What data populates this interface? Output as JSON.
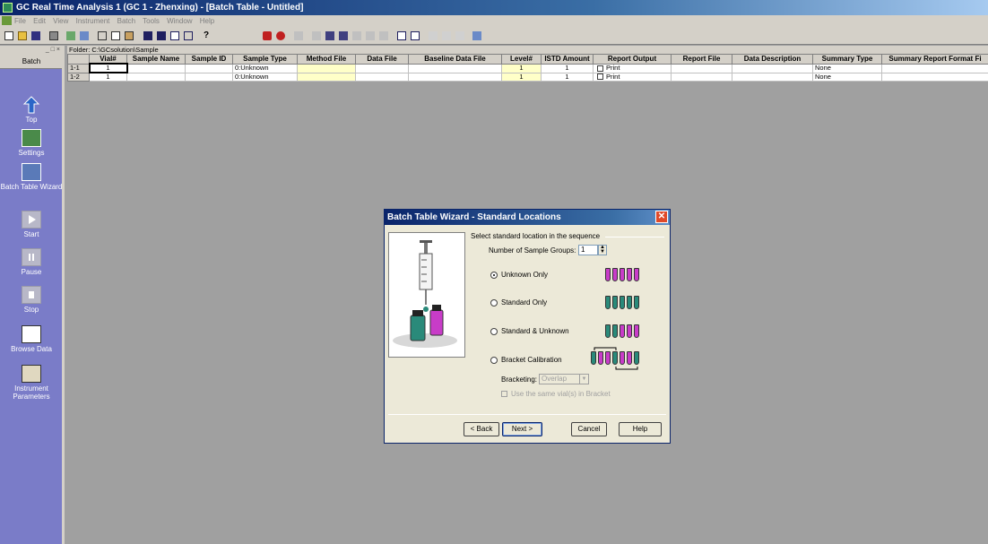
{
  "window": {
    "title": "GC Real Time Analysis 1 (GC 1 - Zhenxing) - [Batch Table - Untitled]"
  },
  "menu": [
    "File",
    "Edit",
    "View",
    "Instrument",
    "Batch",
    "Tools",
    "Window",
    "Help"
  ],
  "sidebar": {
    "header": "Batch",
    "items": [
      {
        "label": "Top",
        "icon": "up-arrow-icon"
      },
      {
        "label": "Settings",
        "icon": "settings-icon"
      },
      {
        "label": "Batch Table Wizard",
        "icon": "wizard-icon"
      },
      {
        "label": "Start",
        "icon": "play-icon"
      },
      {
        "label": "Pause",
        "icon": "pause-icon"
      },
      {
        "label": "Stop",
        "icon": "stop-icon"
      },
      {
        "label": "Browse Data",
        "icon": "browse-data-icon"
      },
      {
        "label": "Instrument Parameters",
        "icon": "instrument-parameters-icon"
      }
    ]
  },
  "folder": "Folder: C:\\GCsolution\\Sample",
  "table": {
    "columns": [
      "",
      "Vial#",
      "Sample Name",
      "Sample ID",
      "Sample Type",
      "Method File",
      "Data File",
      "Baseline Data File",
      "Level#",
      "ISTD Amount",
      "Report Output",
      "Report File",
      "Data Description",
      "Summary Type",
      "Summary Report Format Fi"
    ],
    "rows": [
      {
        "id": "1-1",
        "vial": "1",
        "sample_name": "",
        "sample_id": "",
        "sample_type": "0:Unknown",
        "method_file": "",
        "data_file": "",
        "baseline": "",
        "level": "1",
        "istd": "1",
        "report_output": "Print",
        "report_file": "",
        "data_desc": "",
        "summary_type": "None",
        "summary_format": ""
      },
      {
        "id": "1-2",
        "vial": "1",
        "sample_name": "",
        "sample_id": "",
        "sample_type": "0:Unknown",
        "method_file": "",
        "data_file": "",
        "baseline": "",
        "level": "1",
        "istd": "1",
        "report_output": "Print",
        "report_file": "",
        "data_desc": "",
        "summary_type": "None",
        "summary_format": ""
      }
    ]
  },
  "dialog": {
    "title": "Batch Table Wizard - Standard Locations",
    "prompt": "Select standard location in the sequence",
    "groups_label": "Number of Sample Groups:",
    "groups_value": "1",
    "options": [
      "Unknown Only",
      "Standard Only",
      "Standard & Unknown",
      "Bracket Calibration"
    ],
    "selected": "Unknown Only",
    "bracketing_label": "Bracketing:",
    "bracketing_value": "Overlap",
    "same_vials_label": "Use the same vial(s) in Bracket",
    "buttons": {
      "back": "< Back",
      "next": "Next >",
      "cancel": "Cancel",
      "help": "Help"
    },
    "colors": {
      "standard_vial": "#c83cc8",
      "unknown_vial": "#2a8a7a"
    }
  }
}
